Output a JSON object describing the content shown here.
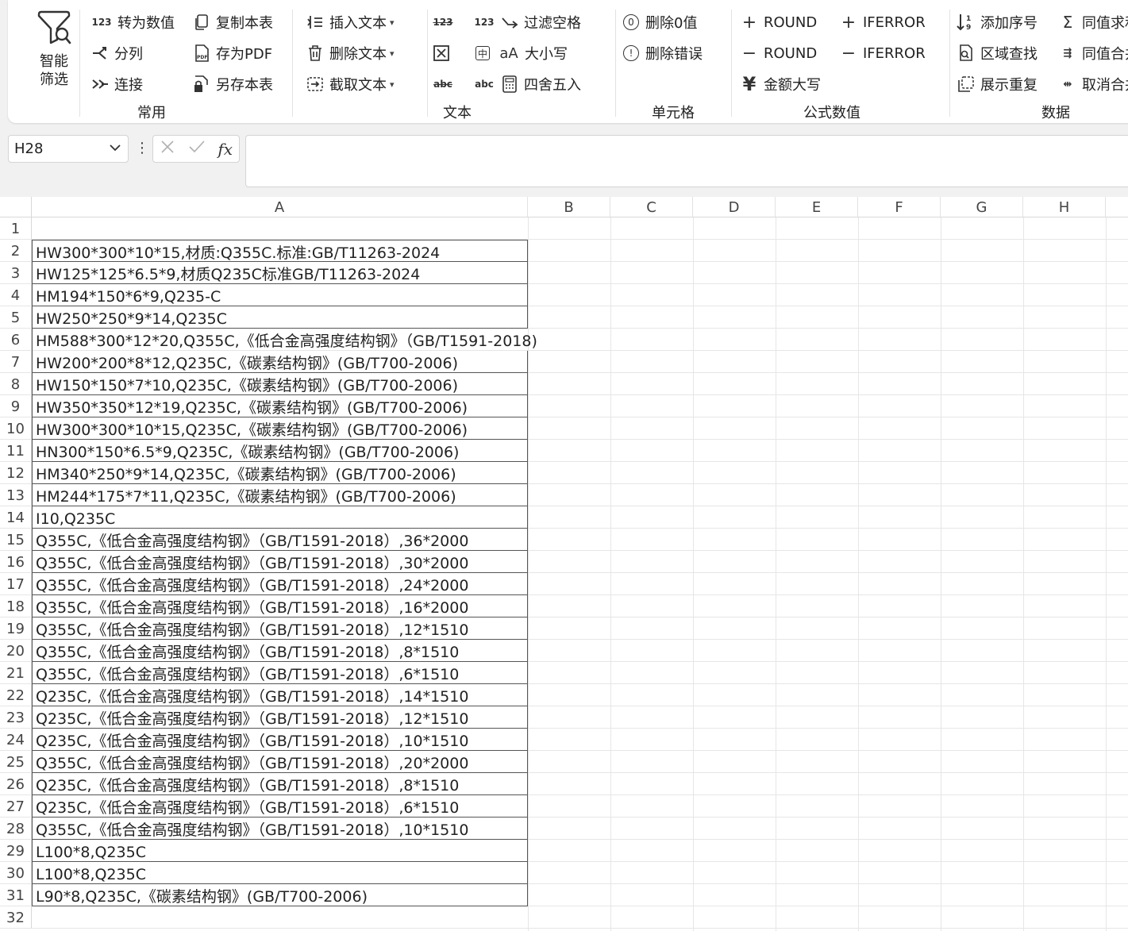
{
  "ribbon": {
    "smart_filter": {
      "line1": "智能",
      "line2": "筛选"
    },
    "common": {
      "label": "常用",
      "items": [
        "转为数值",
        "复制本表",
        "分列",
        "存为PDF",
        "连接",
        "另存本表"
      ]
    },
    "text": {
      "label": "文本",
      "items": [
        "插入文本",
        "删除文本",
        "截取文本",
        "过滤空格",
        "大小写",
        "四舍五入"
      ],
      "small_labels": {
        "n123a": "123",
        "n123b": "123",
        "aa": "aA",
        "abc1": "abc",
        "abc2": "abc",
        "zhong": "中"
      }
    },
    "cell": {
      "label": "单元格",
      "items": [
        "删除0值",
        "删除错误"
      ]
    },
    "formula": {
      "label": "公式数值",
      "items": [
        "ROUND",
        "IFERROR",
        "ROUND",
        "IFERROR",
        "金额大写"
      ],
      "yen": "¥"
    },
    "data": {
      "label": "数据",
      "items": [
        "添加序号",
        "同值求和",
        "区域查找",
        "同值合并",
        "展示重复",
        "取消合并"
      ]
    }
  },
  "formula_bar": {
    "name_box": "H28",
    "fx": "fx",
    "content": ""
  },
  "sheet": {
    "columns": [
      "A",
      "B",
      "C",
      "D",
      "E",
      "F",
      "G",
      "H"
    ],
    "rows": [
      {
        "n": "1",
        "a": ""
      },
      {
        "n": "2",
        "a": "HW300*300*10*15,材质:Q355C.标准:GB/T11263-2024"
      },
      {
        "n": "3",
        "a": "HW125*125*6.5*9,材质Q235C标准GB/T11263-2024"
      },
      {
        "n": "4",
        "a": "HM194*150*6*9,Q235-C"
      },
      {
        "n": "5",
        "a": "HW250*250*9*14,Q235C"
      },
      {
        "n": "6",
        "a": "HM588*300*12*20,Q355C,《低合金高强度结构钢》（GB/T1591-2018)"
      },
      {
        "n": "7",
        "a": "HW200*200*8*12,Q235C,《碳素结构钢》(GB/T700-2006)"
      },
      {
        "n": "8",
        "a": "HW150*150*7*10,Q235C,《碳素结构钢》(GB/T700-2006)"
      },
      {
        "n": "9",
        "a": "HW350*350*12*19,Q235C,《碳素结构钢》(GB/T700-2006)"
      },
      {
        "n": "10",
        "a": "HW300*300*10*15,Q235C,《碳素结构钢》(GB/T700-2006)"
      },
      {
        "n": "11",
        "a": "HN300*150*6.5*9,Q235C,《碳素结构钢》(GB/T700-2006)"
      },
      {
        "n": "12",
        "a": "HM340*250*9*14,Q235C,《碳素结构钢》(GB/T700-2006)"
      },
      {
        "n": "13",
        "a": "HM244*175*7*11,Q235C,《碳素结构钢》(GB/T700-2006)"
      },
      {
        "n": "14",
        "a": "I10,Q235C"
      },
      {
        "n": "15",
        "a": "Q355C,《低合金高强度结构钢》（GB/T1591-2018）,36*2000"
      },
      {
        "n": "16",
        "a": "Q355C,《低合金高强度结构钢》（GB/T1591-2018）,30*2000"
      },
      {
        "n": "17",
        "a": "Q355C,《低合金高强度结构钢》（GB/T1591-2018）,24*2000"
      },
      {
        "n": "18",
        "a": "Q355C,《低合金高强度结构钢》（GB/T1591-2018）,16*2000"
      },
      {
        "n": "19",
        "a": "Q355C,《低合金高强度结构钢》（GB/T1591-2018）,12*1510"
      },
      {
        "n": "20",
        "a": "Q355C,《低合金高强度结构钢》（GB/T1591-2018）,8*1510"
      },
      {
        "n": "21",
        "a": "Q355C,《低合金高强度结构钢》（GB/T1591-2018）,6*1510"
      },
      {
        "n": "22",
        "a": "Q235C,《低合金高强度结构钢》（GB/T1591-2018）,14*1510"
      },
      {
        "n": "23",
        "a": "Q235C,《低合金高强度结构钢》（GB/T1591-2018）,12*1510"
      },
      {
        "n": "24",
        "a": "Q235C,《低合金高强度结构钢》（GB/T1591-2018）,10*1510"
      },
      {
        "n": "25",
        "a": "Q355C,《低合金高强度结构钢》（GB/T1591-2018）,20*2000"
      },
      {
        "n": "26",
        "a": "Q235C,《低合金高强度结构钢》（GB/T1591-2018）,8*1510"
      },
      {
        "n": "27",
        "a": "Q235C,《低合金高强度结构钢》（GB/T1591-2018）,6*1510"
      },
      {
        "n": "28",
        "a": "Q355C,《低合金高强度结构钢》（GB/T1591-2018）,10*1510"
      },
      {
        "n": "29",
        "a": "L100*8,Q235C"
      },
      {
        "n": "30",
        "a": "L100*8,Q235C"
      },
      {
        "n": "31",
        "a": "L90*8,Q235C,《碳素结构钢》(GB/T700-2006)"
      },
      {
        "n": "32",
        "a": ""
      }
    ]
  }
}
